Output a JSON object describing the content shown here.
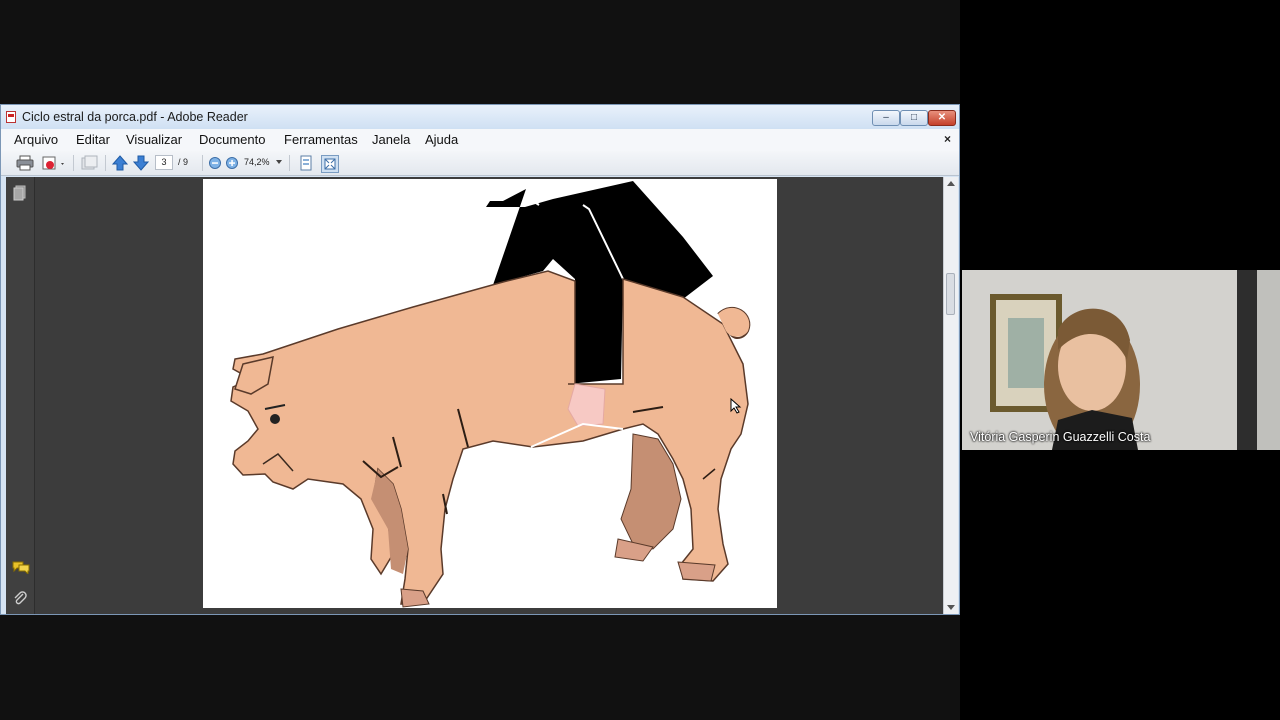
{
  "window": {
    "title": "Ciclo estral da porca.pdf - Adobe Reader",
    "controls": {
      "minimize": "–",
      "maximize": "□",
      "close": "✕"
    }
  },
  "menu": {
    "items": [
      "Arquivo",
      "Editar",
      "Visualizar",
      "Documento",
      "Ferramentas",
      "Janela",
      "Ajuda"
    ],
    "close_doc": "×"
  },
  "toolbar": {
    "current_page": "3",
    "total_pages": "/ 9",
    "zoom": "74,2%",
    "icons": [
      "print-icon",
      "email-icon",
      "previous-page-icon",
      "next-page-icon",
      "zoom-out-icon",
      "zoom-in-icon",
      "fit-page-icon",
      "full-screen-icon"
    ]
  },
  "nav_pane": {
    "icons": [
      "pages-icon",
      "comments-icon",
      "attachments-icon"
    ]
  },
  "document": {
    "page_content": "illustration of a pig with a person's legs"
  },
  "video": {
    "participant_name": "Vitória Gasperin Guazzelli Costa"
  }
}
